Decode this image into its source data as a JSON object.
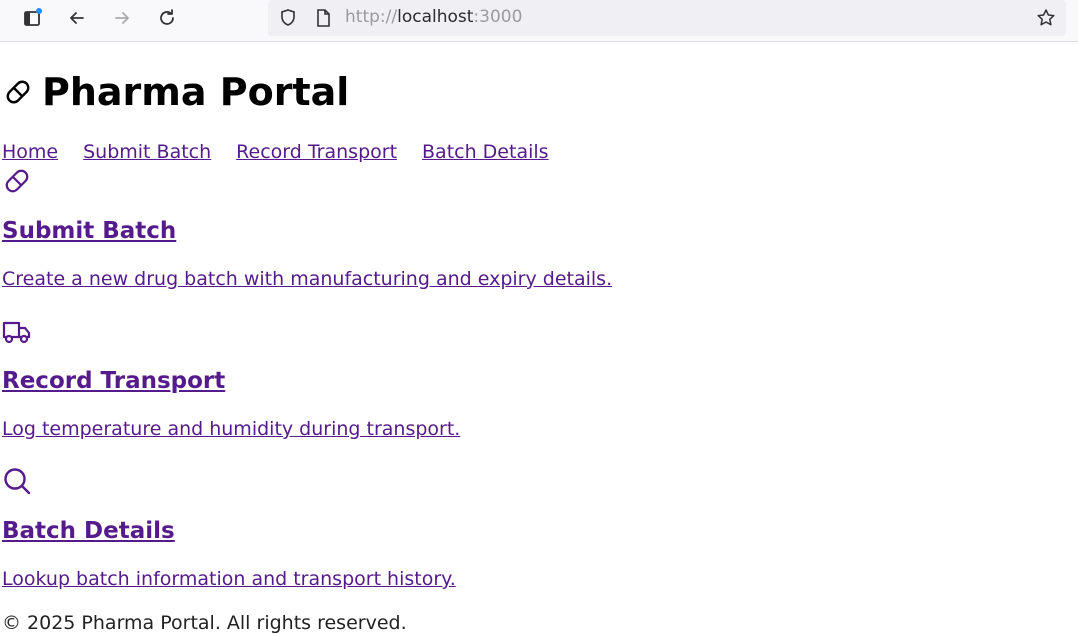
{
  "browser": {
    "url_scheme": "http://",
    "url_host": "localhost",
    "url_port": ":3000",
    "icons": [
      "tab-overview-icon",
      "back-icon",
      "forward-icon",
      "reload-icon",
      "shield-icon",
      "page-icon",
      "bookmark-star-icon"
    ]
  },
  "header": {
    "title": "Pharma Portal",
    "logo_icon": "pill-icon"
  },
  "nav": {
    "items": [
      {
        "label": "Home"
      },
      {
        "label": "Submit Batch"
      },
      {
        "label": "Record Transport"
      },
      {
        "label": "Batch Details"
      }
    ]
  },
  "cards": [
    {
      "icon": "pill-icon",
      "title": "Submit Batch",
      "description": "Create a new drug batch with manufacturing and expiry details."
    },
    {
      "icon": "truck-icon",
      "title": "Record Transport",
      "description": "Log temperature and humidity during transport."
    },
    {
      "icon": "search-icon",
      "title": "Batch Details",
      "description": "Lookup batch information and transport history."
    }
  ],
  "footer": {
    "text": "© 2025 Pharma Portal. All rights reserved."
  },
  "colors": {
    "link": "#551a8b",
    "text": "#000000",
    "background": "#ffffff"
  }
}
